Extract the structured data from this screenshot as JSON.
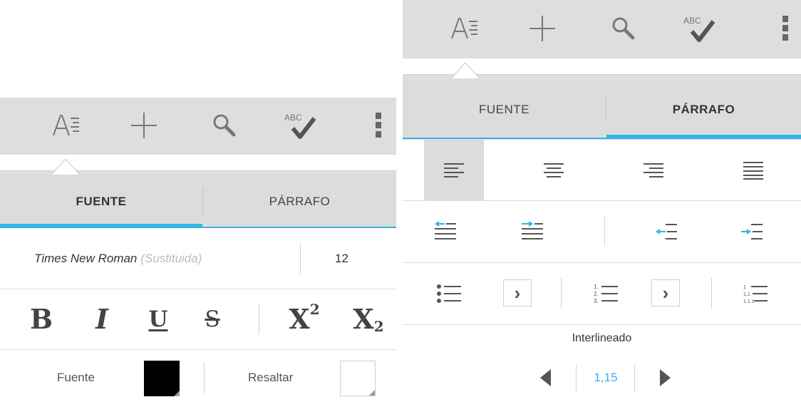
{
  "colors": {
    "accent": "#33b5e5",
    "toolbar_bg": "#dedede",
    "tab_bg": "#dcdcdc",
    "muted_text": "#bbbbbb",
    "font_color": "#000000",
    "highlight_color": "#ffffff"
  },
  "toolbar": {
    "icons": [
      "format-text-icon",
      "add-icon",
      "search-icon",
      "spellcheck-icon",
      "overflow-menu-icon"
    ],
    "spellcheck_label": "ABC"
  },
  "tabs": {
    "fuente": "FUENTE",
    "parrafo": "PÁRRAFO"
  },
  "left_panel": {
    "active_tab": "FUENTE",
    "font_name": "Times New Roman",
    "font_substituted": "(Sustituida)",
    "font_size": "12",
    "format_buttons": {
      "bold": "B",
      "italic": "I",
      "underline": "U",
      "strikethrough": "S",
      "superscript_base": "X",
      "superscript_exp": "2",
      "subscript_base": "X",
      "subscript_exp": "2"
    },
    "font_color_label": "Fuente",
    "highlight_label": "Resaltar"
  },
  "right_panel": {
    "active_tab": "PÁRRAFO",
    "alignment": [
      "align-left",
      "align-center",
      "align-right",
      "align-justify"
    ],
    "selected_alignment": "align-left",
    "list_numbers": [
      "1.",
      "2.",
      "3."
    ],
    "multilevel_numbers": [
      "1",
      "1.1",
      "1.1.1"
    ],
    "chevron": "›",
    "line_spacing_label": "Interlineado",
    "line_spacing_value": "1,15"
  }
}
